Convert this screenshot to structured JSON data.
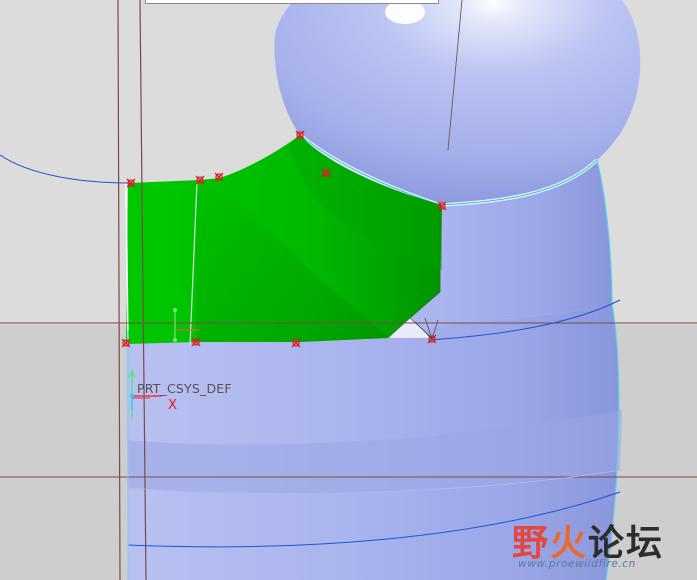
{
  "viewport": {
    "csys_label": "PRT_CSYS_DEF",
    "x_axis_label": "X"
  },
  "watermark": {
    "title_part1": "野",
    "title_part2": "火",
    "title_part3": "论坛",
    "url": "www.proewildfire.cn"
  },
  "colors": {
    "background_upper": "#dcdcdc",
    "background_lower": "#cecece",
    "body_fill": "#a9b4ee",
    "surface_highlight": "#00c400",
    "surface_shadow": "#009e00",
    "datum_line": "#7a4a4a",
    "edge_curve": "#1a55d8",
    "vertex_marker": "#d82020"
  }
}
